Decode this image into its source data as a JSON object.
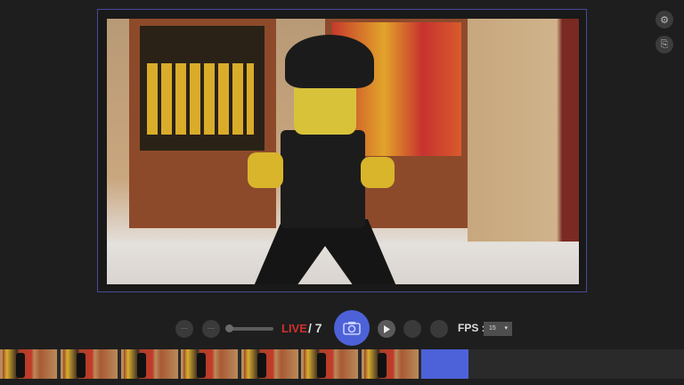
{
  "controls": {
    "live_label": "LIVE",
    "frame_count": "/ 7",
    "fps_label": "FPS :",
    "fps_value": "15",
    "capture_icon": "camera-icon"
  },
  "side": {
    "settings_icon": "gear-icon",
    "overlay_icon": "export-icon"
  },
  "filmstrip": {
    "frame_count": 7
  },
  "colors": {
    "accent": "#4d62d8",
    "live": "#d0302c"
  }
}
